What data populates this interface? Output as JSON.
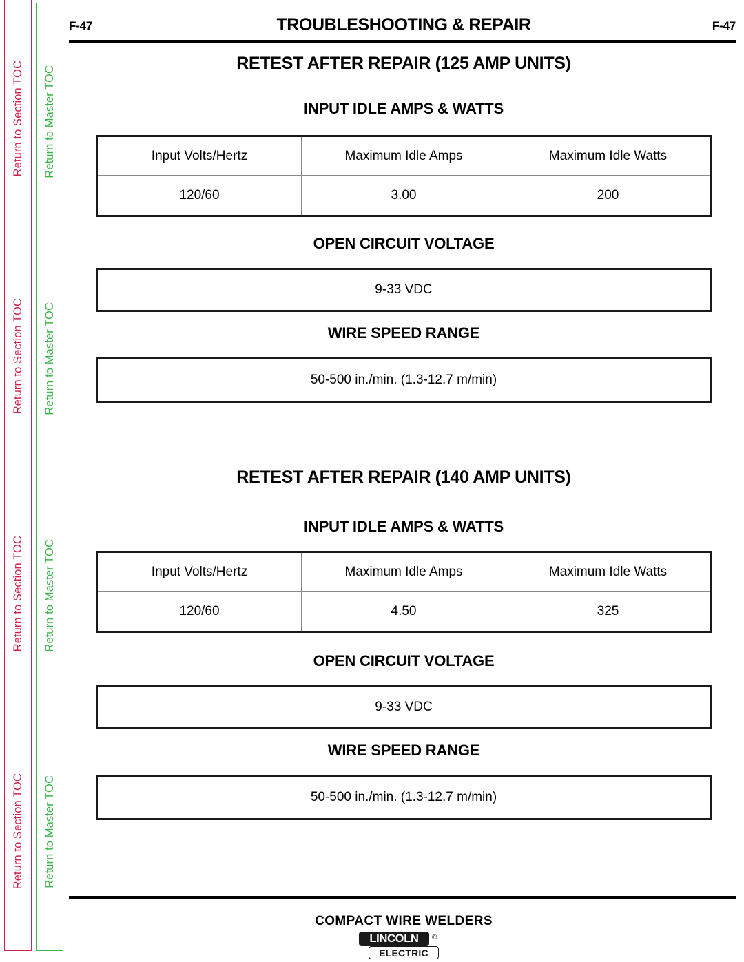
{
  "sidebar": {
    "repeat_count": 4,
    "section_toc": {
      "label": "Return to Section TOC",
      "color": "#D0214B"
    },
    "master_toc": {
      "label": "Return to Master TOC",
      "color": "#3BB54A"
    }
  },
  "header": {
    "folio_left": "F-47",
    "folio_right": "F-47",
    "title": "TROUBLESHOOTING & REPAIR"
  },
  "sections": [
    {
      "title": "RETEST AFTER REPAIR  (125 AMP UNITS)",
      "idle": {
        "heading": "INPUT IDLE AMPS & WATTS",
        "columns": [
          "Input Volts/Hertz",
          "Maximum Idle Amps",
          "Maximum Idle Watts"
        ],
        "row": [
          "120/60",
          "3.00",
          "200"
        ]
      },
      "ocv": {
        "heading": "OPEN CIRCUIT VOLTAGE",
        "value": "9-33 VDC"
      },
      "wire_speed": {
        "heading": "WIRE SPEED RANGE",
        "value": "50-500 in./min. (1.3-12.7 m/min)"
      }
    },
    {
      "title": "RETEST AFTER REPAIR  (140 AMP UNITS)",
      "idle": {
        "heading": "INPUT IDLE AMPS & WATTS",
        "columns": [
          "Input Volts/Hertz",
          "Maximum Idle Amps",
          "Maximum Idle Watts"
        ],
        "row": [
          "120/60",
          "4.50",
          "325"
        ]
      },
      "ocv": {
        "heading": "OPEN CIRCUIT VOLTAGE",
        "value": "9-33 VDC"
      },
      "wire_speed": {
        "heading": "WIRE SPEED RANGE",
        "value": "50-500 in./min. (1.3-12.7 m/min)"
      }
    }
  ],
  "footer": {
    "product_line": "COMPACT WIRE WELDERS",
    "logo": {
      "primary": "LINCOLN",
      "registered": "®",
      "secondary": "ELECTRIC"
    }
  }
}
